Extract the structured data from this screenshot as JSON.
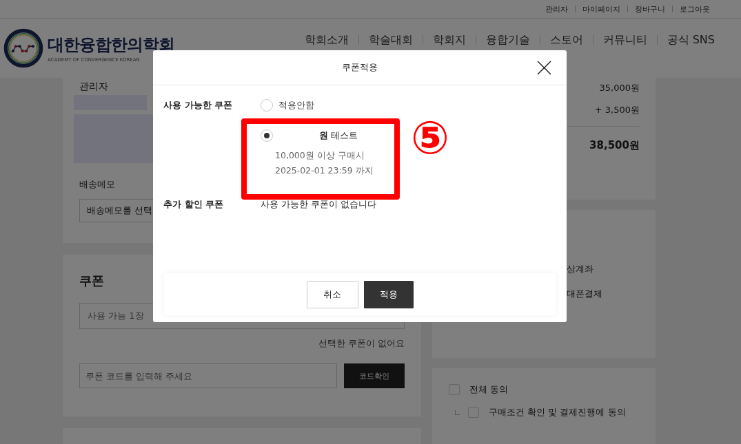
{
  "top_links": [
    "관리자",
    "마이페이지",
    "장바구니",
    "로그아웃"
  ],
  "logo": {
    "title": "대한융합한의학회",
    "subtitle": "ACADEMY OF CONVERGENCE KOREAN"
  },
  "nav": [
    "학회소개",
    "학술대회",
    "학회지",
    "융합기술",
    "스토어",
    "커뮤니티",
    "공식 SNS"
  ],
  "orderer": {
    "name": "관리자"
  },
  "delivery_memo": {
    "label": "배송메모",
    "value": "배송메모를 선택"
  },
  "coupon_section": {
    "title": "쿠폰",
    "select": "사용 가능 1장",
    "status": "선택한 쿠폰이 없어요",
    "code_placeholder": "쿠폰 코드를 입력해 주세요",
    "code_button": "코드확인"
  },
  "summary": {
    "rows": [
      "35,000원",
      "+ 3,500원"
    ],
    "total": "38,500원"
  },
  "payment_methods": [
    "상계좌",
    "대폰결제"
  ],
  "agreements": [
    {
      "label": "전체 동의",
      "checked": false,
      "children": [
        {
          "label": "구매조건 확인 및 결제진행에 동의",
          "checked": false
        }
      ]
    }
  ],
  "modal": {
    "title": "쿠폰적용",
    "sections": [
      {
        "label": "사용 가능한 쿠폰",
        "kind": "options",
        "options": [
          {
            "label": "적용안함",
            "selected": false
          },
          {
            "label": "**원** 테스트",
            "details": [
              "10,000원 이상 구매시",
              "2025-02-01 23:59 까지"
            ],
            "selected": true
          }
        ]
      },
      {
        "label": "추가 할인 쿠폰",
        "kind": "message",
        "message": "사용 가능한 쿠폰이 없습니다"
      }
    ],
    "buttons": [
      {
        "label": "취소",
        "kind": "secondary"
      },
      {
        "label": "적용",
        "kind": "primary"
      }
    ]
  },
  "annotation": {
    "label": "⑤"
  }
}
